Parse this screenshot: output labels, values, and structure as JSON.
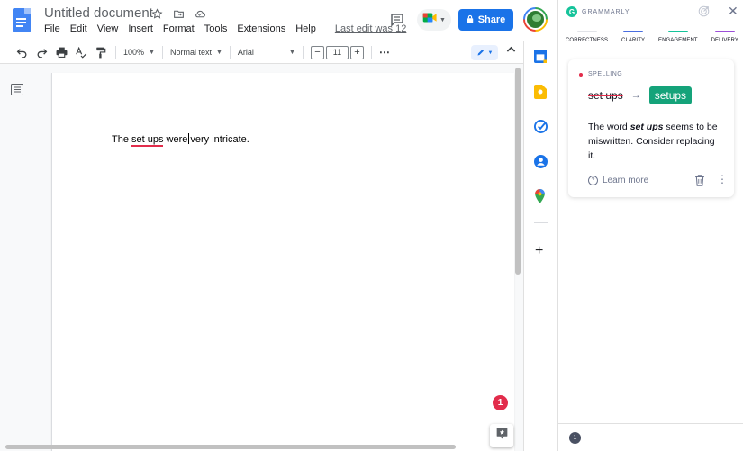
{
  "docs": {
    "title": "Untitled document",
    "menu": [
      "File",
      "Edit",
      "View",
      "Insert",
      "Format",
      "Tools",
      "Extensions",
      "Help"
    ],
    "last_edit": "Last edit was 12",
    "share_label": "Share"
  },
  "toolbar": {
    "zoom": "100%",
    "style": "Normal text",
    "font": "Arial",
    "font_size": "11",
    "decrease": "−",
    "increase": "+",
    "more": "⋯"
  },
  "document": {
    "text_before": "The ",
    "error_text": "set ups",
    "text_after_1": " were",
    "text_after_2": "very intricate."
  },
  "issues_badge": "1",
  "grammarly": {
    "brand": "GRAMMARLY",
    "tabs": [
      {
        "label": "CORRECTNESS",
        "color": "#e1e3e8"
      },
      {
        "label": "CLARITY",
        "color": "#4a6ee0"
      },
      {
        "label": "ENGAGEMENT",
        "color": "#15c39a"
      },
      {
        "label": "DELIVERY",
        "color": "#9c4fd8"
      }
    ],
    "card": {
      "category": "SPELLING",
      "old": "set ups",
      "arrow": "→",
      "new": "setups",
      "explain_pre": "The word ",
      "explain_word": "set ups",
      "explain_post": " seems to be miswritten. Consider replacing it.",
      "learn_more": "Learn more"
    },
    "footer_count": "1"
  },
  "colors": {
    "docs_blue": "#1a73e8",
    "grammarly_green": "#15c39a",
    "error_red": "#e22c4b"
  }
}
